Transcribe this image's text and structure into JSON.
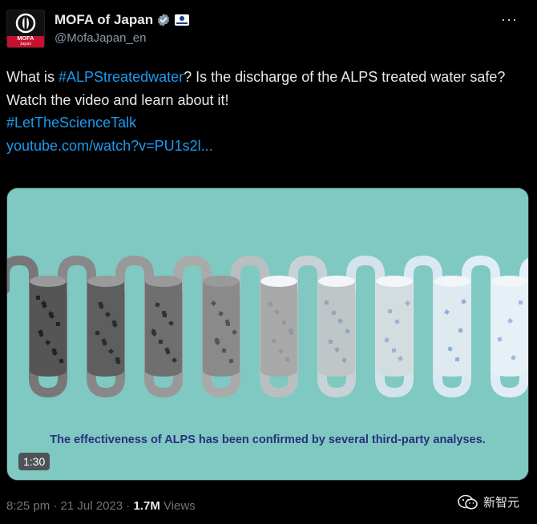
{
  "account": {
    "display_name": "MOFA of Japan",
    "handle": "@MofaJapan_en",
    "avatar_label": "MOFA",
    "avatar_sublabel": "Japan",
    "more_label": "···"
  },
  "tweet": {
    "line1_prefix": "What is ",
    "line1_hashtag": "#ALPStreatedwater",
    "line1_suffix": "? Is the discharge of the ALPS treated water safe?",
    "line2": "Watch the video and learn about it!",
    "hashtag2": "#LetTheScienceTalk",
    "link": "youtube.com/watch?v=PU1s2l..."
  },
  "video": {
    "caption": "The effectiveness of ALPS has been confirmed by several third-party analyses.",
    "duration": "1:30",
    "background_color": "#7fc9c2"
  },
  "meta": {
    "time": "8:25 pm",
    "separator1": " · ",
    "date": "21 Jul 2023",
    "separator2": " · ",
    "views_count": "1.7M",
    "views_label": " Views"
  },
  "watermark": {
    "text": "新智元"
  }
}
